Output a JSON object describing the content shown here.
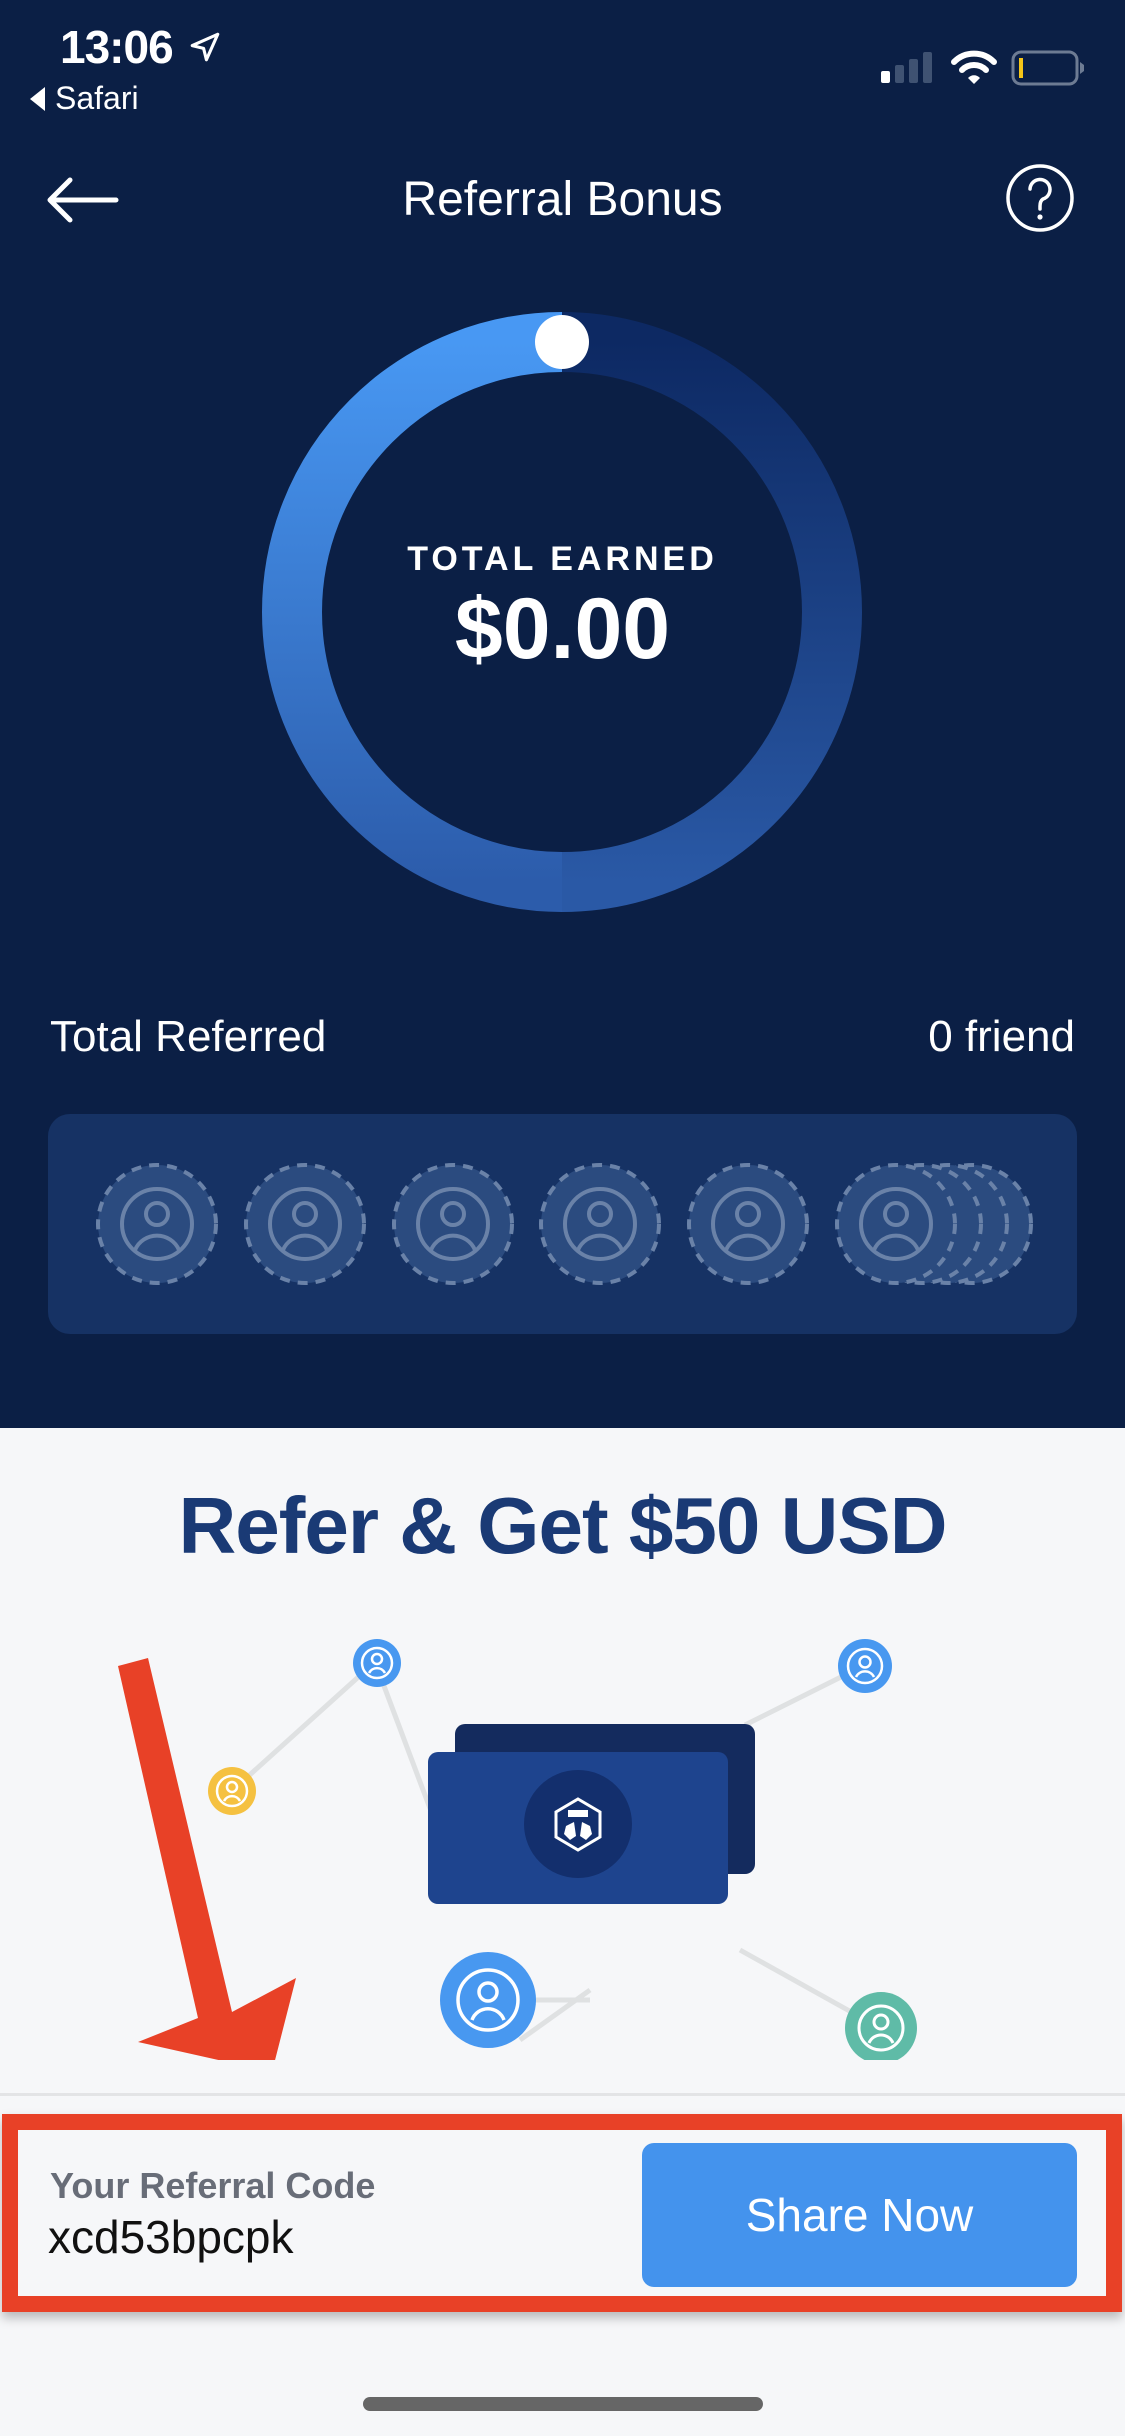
{
  "status_bar": {
    "time": "13:06",
    "back_app": "Safari",
    "signal_bars_active": 1,
    "signal_bars_total": 4,
    "battery_level": "low"
  },
  "nav": {
    "title": "Referral Bonus",
    "back_icon": "arrow-left-icon",
    "help_icon": "question-circle-icon"
  },
  "earnings": {
    "label": "TOTAL EARNED",
    "amount": "$0.00",
    "progress": 0
  },
  "referrals": {
    "label": "Total Referred",
    "count_text": "0 friend",
    "slots": 6
  },
  "promo": {
    "title": "Refer & Get $50 USD"
  },
  "referral_code": {
    "label": "Your Referral Code",
    "code": "xcd53bpcpk",
    "share_label": "Share Now"
  },
  "colors": {
    "header_bg": "#0b1f45",
    "accent_blue": "#4493ed",
    "promo_title": "#1a3a75",
    "annotation_red": "#e84127",
    "page_bg": "#f6f7f9"
  }
}
